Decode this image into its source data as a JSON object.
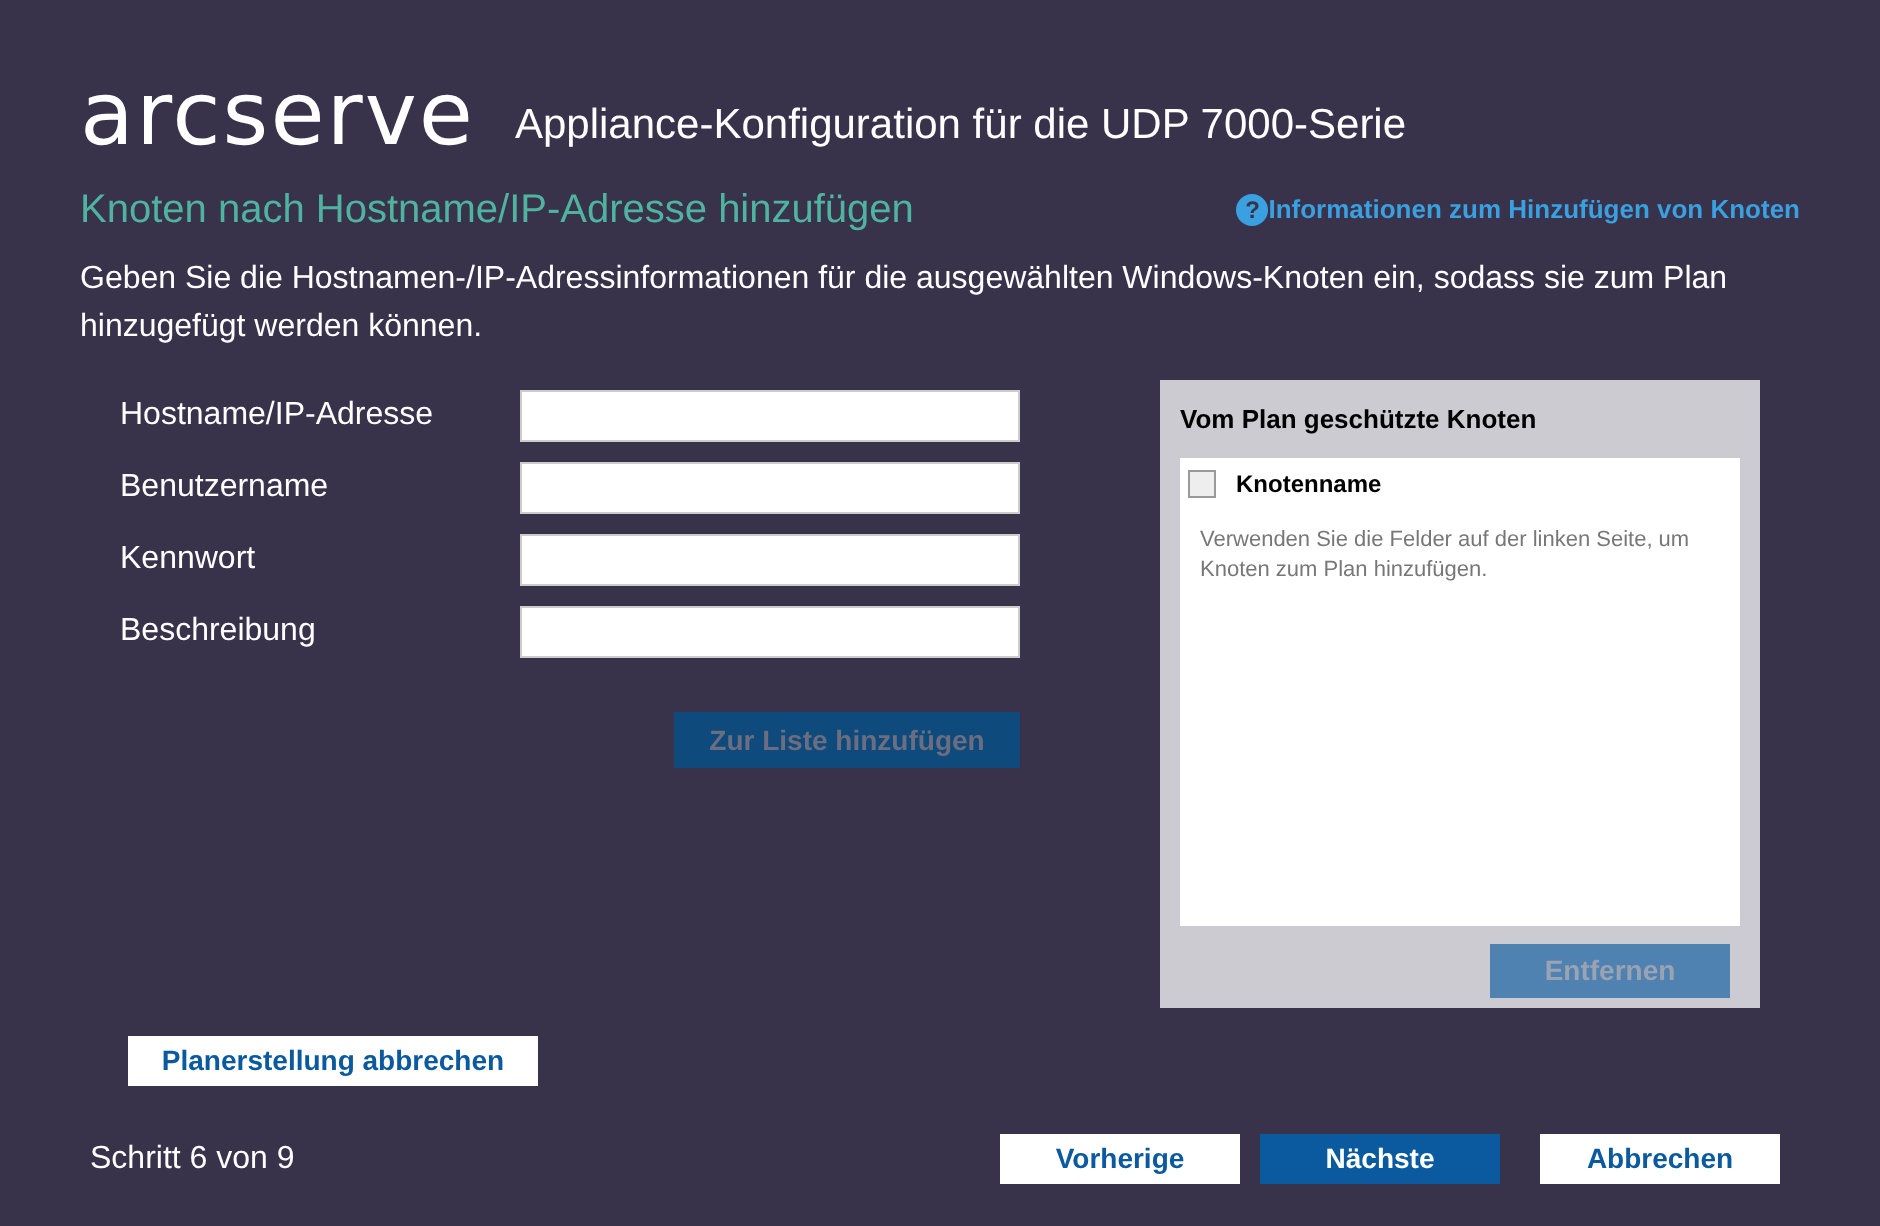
{
  "header": {
    "logo": "arcserve",
    "title": "Appliance-Konfiguration für die UDP 7000-Serie"
  },
  "page": {
    "heading": "Knoten nach Hostname/IP-Adresse hinzufügen",
    "help_link": "Informationen zum Hinzufügen von Knoten",
    "help_icon": "?",
    "intro": "Geben Sie die Hostnamen-/IP-Adressinformationen für die ausgewählten Windows-Knoten ein, sodass sie zum Plan hinzugefügt werden können."
  },
  "form": {
    "fields": [
      {
        "label": "Hostname/IP-Adresse"
      },
      {
        "label": "Benutzername"
      },
      {
        "label": "Kennwort"
      },
      {
        "label": "Beschreibung"
      }
    ],
    "add_button": {
      "label": "Zur Liste hinzufügen",
      "disabled": true
    }
  },
  "node_panel": {
    "title": "Vom Plan geschützte Knoten",
    "column": "Knotenname",
    "select_all_checked": false,
    "empty_text": "Verwenden Sie die Felder auf der linken Seite, um Knoten zum Plan hinzufügen.",
    "remove_button": {
      "label": "Entfernen",
      "disabled": true
    }
  },
  "cancel_plan_button": "Planerstellung abbrechen",
  "footer": {
    "step": "Schritt 6 von 9",
    "buttons": [
      {
        "label": "Vorherige",
        "kind": "secondary"
      },
      {
        "label": "Nächste",
        "kind": "primary"
      },
      {
        "label": "Abbrechen",
        "kind": "secondary"
      }
    ]
  }
}
